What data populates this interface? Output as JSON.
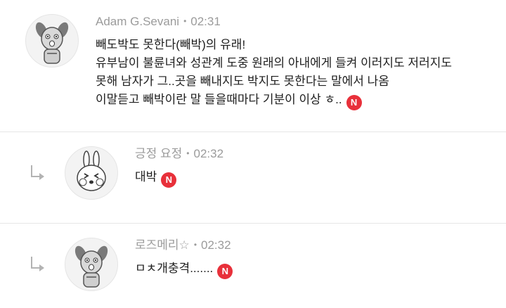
{
  "comments": [
    {
      "author": "Adam G.Sevani",
      "separator": "•",
      "time": "02:31",
      "lines": [
        "빼도박도 못한다(빼박)의 유래!",
        "유부남이 불륜녀와 성관계 도중 원래의 아내에게 들켜 이러지도 저러지도",
        "못해 남자가 그..곳을 빼내지도 박지도 못한다는 말에서 나옴",
        "이말듣고 빼박이란 말 들을때마다 기분이 이상 ㅎ.."
      ],
      "new_badge": "N",
      "avatar_icon": "dog-character-icon"
    },
    {
      "author": "긍정 요정",
      "separator": "•",
      "time": "02:32",
      "lines": [
        "대박"
      ],
      "new_badge": "N",
      "avatar_icon": "bunny-character-icon",
      "reply_icon": "reply-arrow-icon"
    },
    {
      "author": "로즈메리☆",
      "separator": "•",
      "time": "02:32",
      "lines": [
        "ㅁㅊ개충격......."
      ],
      "new_badge": "N",
      "avatar_icon": "dog-character-icon",
      "reply_icon": "reply-arrow-icon"
    }
  ],
  "colors": {
    "badge": "#e8303a",
    "meta": "#9b9b9b",
    "divider": "#e6e6e6"
  }
}
